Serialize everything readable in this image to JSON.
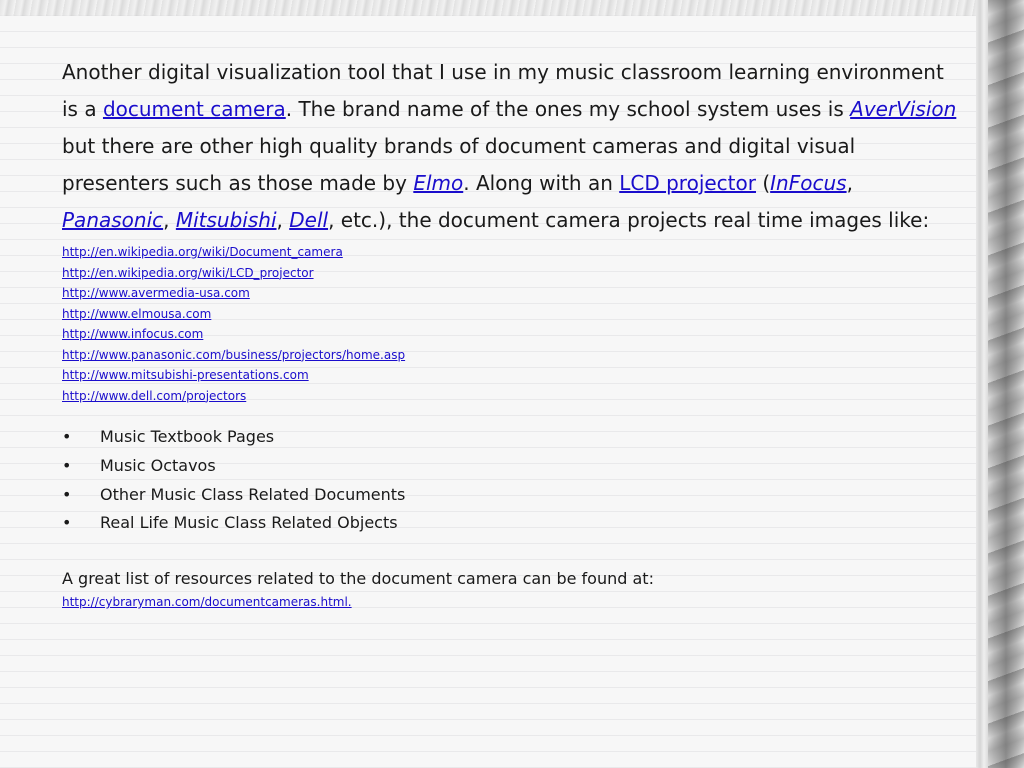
{
  "intro": {
    "t1": "Another digital visualization tool that I use in my music classroom learning environment is a ",
    "link_document_camera": "document camera",
    "t2": ". The brand name of the ones my school system uses is ",
    "link_avervision": "AverVision",
    "t3": " but there are other high quality brands of document cameras and digital visual presenters such as those made by ",
    "link_elmo": "Elmo",
    "t4": ".  Along with an ",
    "link_lcd_projector": "LCD projector",
    "t5": " (",
    "link_infocus": "InFocus",
    "sep1": ", ",
    "link_panasonic": "Panasonic",
    "sep2": ", ",
    "link_mitsubishi": "Mitsubishi",
    "sep3": ", ",
    "link_dell": "Dell",
    "t6": ", etc.), the document camera projects real time images like:"
  },
  "urls": [
    "http://en.wikipedia.org/wiki/Document_camera",
    "http://en.wikipedia.org/wiki/LCD_projector",
    "http://www.avermedia-usa.com",
    "http://www.elmousa.com",
    "http://www.infocus.com",
    "http://www.panasonic.com/business/projectors/home.asp",
    "http://www.mitsubishi-presentations.com",
    "http://www.dell.com/projectors"
  ],
  "bullet_symbol": "•",
  "bullets": [
    "Music Textbook Pages",
    "Music Octavos",
    "Other Music Class Related Documents",
    "Real Life Music Class Related Objects"
  ],
  "resources_text": "A great list of resources related to the document camera can be found at:",
  "resources_url": "http://cybraryman.com/documentcameras.html.",
  "colors": {
    "link": "#1a0dcc",
    "text": "#1a1a1a",
    "background": "#f7f7f7"
  }
}
